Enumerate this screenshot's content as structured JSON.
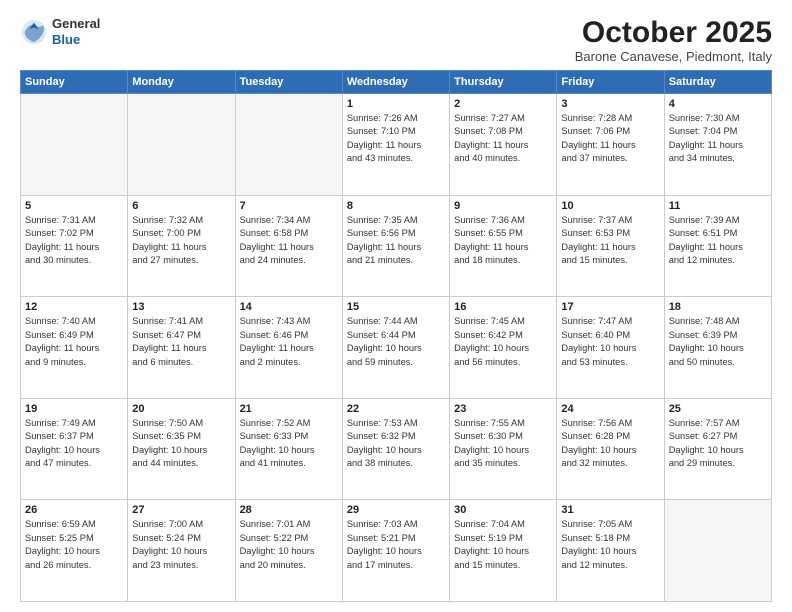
{
  "logo": {
    "general": "General",
    "blue": "Blue"
  },
  "title": "October 2025",
  "subtitle": "Barone Canavese, Piedmont, Italy",
  "days_header": [
    "Sunday",
    "Monday",
    "Tuesday",
    "Wednesday",
    "Thursday",
    "Friday",
    "Saturday"
  ],
  "weeks": [
    [
      {
        "day": "",
        "info": ""
      },
      {
        "day": "",
        "info": ""
      },
      {
        "day": "",
        "info": ""
      },
      {
        "day": "1",
        "info": "Sunrise: 7:26 AM\nSunset: 7:10 PM\nDaylight: 11 hours\nand 43 minutes."
      },
      {
        "day": "2",
        "info": "Sunrise: 7:27 AM\nSunset: 7:08 PM\nDaylight: 11 hours\nand 40 minutes."
      },
      {
        "day": "3",
        "info": "Sunrise: 7:28 AM\nSunset: 7:06 PM\nDaylight: 11 hours\nand 37 minutes."
      },
      {
        "day": "4",
        "info": "Sunrise: 7:30 AM\nSunset: 7:04 PM\nDaylight: 11 hours\nand 34 minutes."
      }
    ],
    [
      {
        "day": "5",
        "info": "Sunrise: 7:31 AM\nSunset: 7:02 PM\nDaylight: 11 hours\nand 30 minutes."
      },
      {
        "day": "6",
        "info": "Sunrise: 7:32 AM\nSunset: 7:00 PM\nDaylight: 11 hours\nand 27 minutes."
      },
      {
        "day": "7",
        "info": "Sunrise: 7:34 AM\nSunset: 6:58 PM\nDaylight: 11 hours\nand 24 minutes."
      },
      {
        "day": "8",
        "info": "Sunrise: 7:35 AM\nSunset: 6:56 PM\nDaylight: 11 hours\nand 21 minutes."
      },
      {
        "day": "9",
        "info": "Sunrise: 7:36 AM\nSunset: 6:55 PM\nDaylight: 11 hours\nand 18 minutes."
      },
      {
        "day": "10",
        "info": "Sunrise: 7:37 AM\nSunset: 6:53 PM\nDaylight: 11 hours\nand 15 minutes."
      },
      {
        "day": "11",
        "info": "Sunrise: 7:39 AM\nSunset: 6:51 PM\nDaylight: 11 hours\nand 12 minutes."
      }
    ],
    [
      {
        "day": "12",
        "info": "Sunrise: 7:40 AM\nSunset: 6:49 PM\nDaylight: 11 hours\nand 9 minutes."
      },
      {
        "day": "13",
        "info": "Sunrise: 7:41 AM\nSunset: 6:47 PM\nDaylight: 11 hours\nand 6 minutes."
      },
      {
        "day": "14",
        "info": "Sunrise: 7:43 AM\nSunset: 6:46 PM\nDaylight: 11 hours\nand 2 minutes."
      },
      {
        "day": "15",
        "info": "Sunrise: 7:44 AM\nSunset: 6:44 PM\nDaylight: 10 hours\nand 59 minutes."
      },
      {
        "day": "16",
        "info": "Sunrise: 7:45 AM\nSunset: 6:42 PM\nDaylight: 10 hours\nand 56 minutes."
      },
      {
        "day": "17",
        "info": "Sunrise: 7:47 AM\nSunset: 6:40 PM\nDaylight: 10 hours\nand 53 minutes."
      },
      {
        "day": "18",
        "info": "Sunrise: 7:48 AM\nSunset: 6:39 PM\nDaylight: 10 hours\nand 50 minutes."
      }
    ],
    [
      {
        "day": "19",
        "info": "Sunrise: 7:49 AM\nSunset: 6:37 PM\nDaylight: 10 hours\nand 47 minutes."
      },
      {
        "day": "20",
        "info": "Sunrise: 7:50 AM\nSunset: 6:35 PM\nDaylight: 10 hours\nand 44 minutes."
      },
      {
        "day": "21",
        "info": "Sunrise: 7:52 AM\nSunset: 6:33 PM\nDaylight: 10 hours\nand 41 minutes."
      },
      {
        "day": "22",
        "info": "Sunrise: 7:53 AM\nSunset: 6:32 PM\nDaylight: 10 hours\nand 38 minutes."
      },
      {
        "day": "23",
        "info": "Sunrise: 7:55 AM\nSunset: 6:30 PM\nDaylight: 10 hours\nand 35 minutes."
      },
      {
        "day": "24",
        "info": "Sunrise: 7:56 AM\nSunset: 6:28 PM\nDaylight: 10 hours\nand 32 minutes."
      },
      {
        "day": "25",
        "info": "Sunrise: 7:57 AM\nSunset: 6:27 PM\nDaylight: 10 hours\nand 29 minutes."
      }
    ],
    [
      {
        "day": "26",
        "info": "Sunrise: 6:59 AM\nSunset: 5:25 PM\nDaylight: 10 hours\nand 26 minutes."
      },
      {
        "day": "27",
        "info": "Sunrise: 7:00 AM\nSunset: 5:24 PM\nDaylight: 10 hours\nand 23 minutes."
      },
      {
        "day": "28",
        "info": "Sunrise: 7:01 AM\nSunset: 5:22 PM\nDaylight: 10 hours\nand 20 minutes."
      },
      {
        "day": "29",
        "info": "Sunrise: 7:03 AM\nSunset: 5:21 PM\nDaylight: 10 hours\nand 17 minutes."
      },
      {
        "day": "30",
        "info": "Sunrise: 7:04 AM\nSunset: 5:19 PM\nDaylight: 10 hours\nand 15 minutes."
      },
      {
        "day": "31",
        "info": "Sunrise: 7:05 AM\nSunset: 5:18 PM\nDaylight: 10 hours\nand 12 minutes."
      },
      {
        "day": "",
        "info": ""
      }
    ]
  ]
}
